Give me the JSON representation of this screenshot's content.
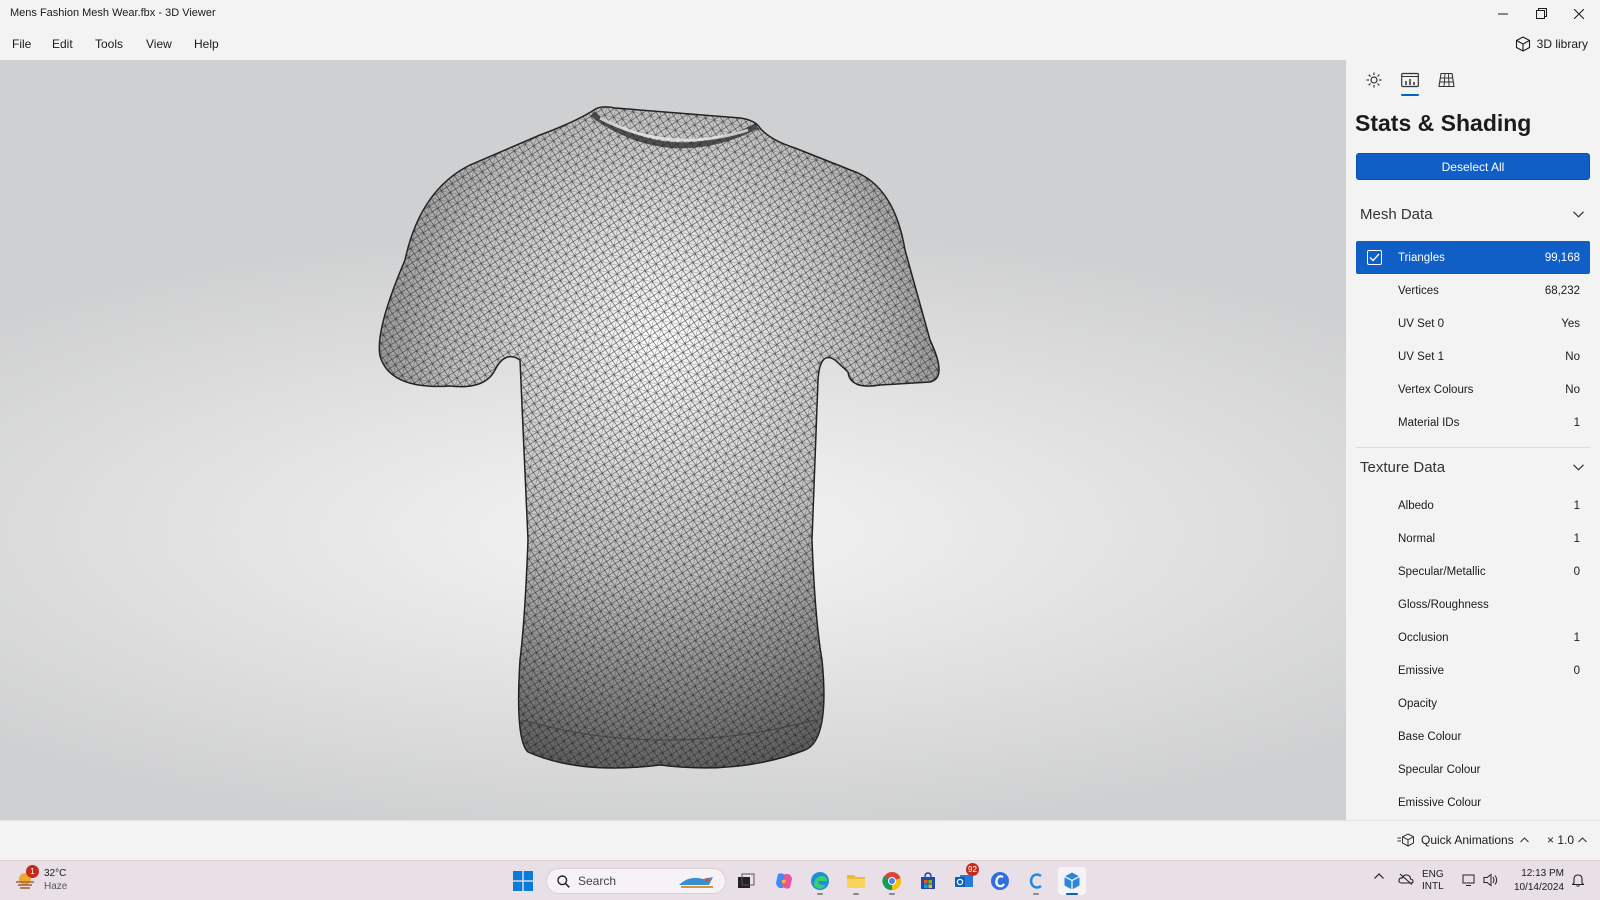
{
  "window": {
    "title": "Mens Fashion Mesh Wear.fbx - 3D Viewer",
    "controls": {
      "minimize_icon": "minimize-icon",
      "restore_icon": "restore-icon",
      "close_icon": "close-icon"
    }
  },
  "menu": {
    "items": [
      "File",
      "Edit",
      "Tools",
      "View",
      "Help"
    ],
    "library_label": "3D library"
  },
  "viewport": {
    "model_description_icon": "t-shirt-wireframe"
  },
  "panel": {
    "tabs": [
      "lighting-tab",
      "stats-tab",
      "grid-tab"
    ],
    "active_tab": "stats-tab",
    "title": "Stats & Shading",
    "deselect_label": "Deselect All",
    "mesh_section": {
      "label": "Mesh Data",
      "rows": [
        {
          "label": "Triangles",
          "value": "99,168",
          "selected": true
        },
        {
          "label": "Vertices",
          "value": "68,232"
        },
        {
          "label": "UV Set 0",
          "value": "Yes"
        },
        {
          "label": "UV Set 1",
          "value": "No"
        },
        {
          "label": "Vertex Colours",
          "value": "No"
        },
        {
          "label": "Material IDs",
          "value": "1"
        }
      ]
    },
    "texture_section": {
      "label": "Texture Data",
      "rows": [
        {
          "label": "Albedo",
          "value": "1"
        },
        {
          "label": "Normal",
          "value": "1"
        },
        {
          "label": "Specular/Metallic",
          "value": "0"
        },
        {
          "label": "Gloss/Roughness",
          "value": ""
        },
        {
          "label": "Occlusion",
          "value": "1"
        },
        {
          "label": "Emissive",
          "value": "0"
        },
        {
          "label": "Opacity",
          "value": ""
        },
        {
          "label": "Base Colour",
          "value": ""
        },
        {
          "label": "Specular Colour",
          "value": ""
        },
        {
          "label": "Emissive Colour",
          "value": ""
        }
      ]
    }
  },
  "bottombar": {
    "quick_animations": "Quick Animations",
    "speed": "× 1.0"
  },
  "taskbar": {
    "weather": {
      "temp": "32°C",
      "condition": "Haze",
      "badge": "1"
    },
    "search_placeholder": "Search",
    "mail_badge": "92",
    "language": {
      "line1": "ENG",
      "line2": "INTL"
    },
    "clock": {
      "time": "12:13 PM",
      "date": "10/14/2024"
    }
  },
  "colors": {
    "accent": "#0f5fc6",
    "taskbar": "#e9dfe6",
    "panel": "#f3f3f3"
  }
}
